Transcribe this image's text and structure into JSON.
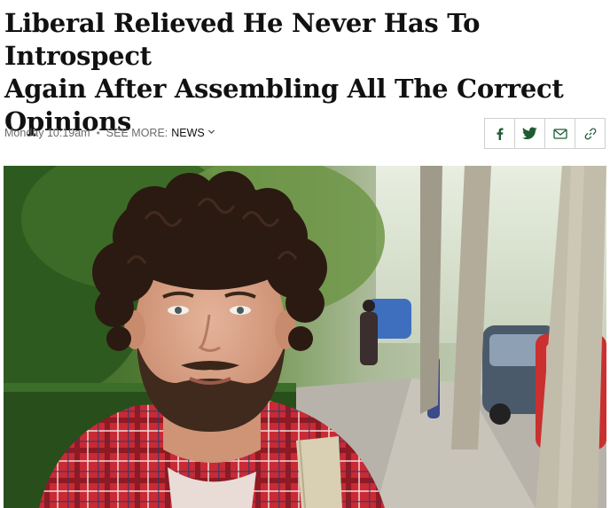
{
  "article": {
    "headline_line1": "Liberal Relieved He Never Has To Introspect",
    "headline_line2": "Again After Assembling All The Correct",
    "headline_line3": "Opinions"
  },
  "meta": {
    "timestamp": "Monday 10:19am",
    "separator": "•",
    "see_more_label": "SEE MORE:",
    "section": "NEWS",
    "chevron": "⌄"
  },
  "share": {
    "icons": [
      "facebook-icon",
      "twitter-icon",
      "email-icon",
      "link-icon"
    ],
    "brand_color": "#1e5b32"
  },
  "photo": {
    "subject": "young bearded man with curly hair in red plaid shirt on tree-lined sidewalk"
  }
}
